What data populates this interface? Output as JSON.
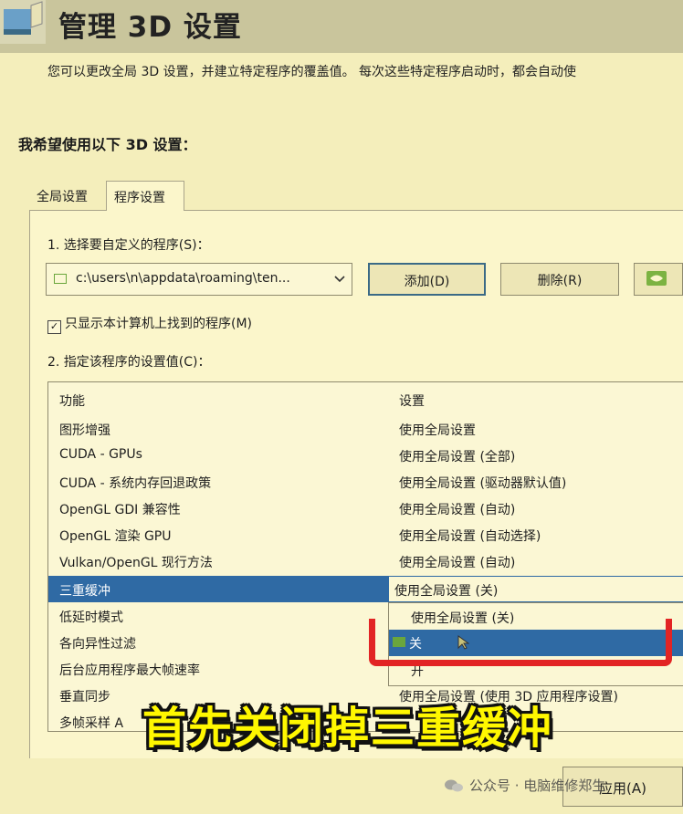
{
  "window": {
    "title": "管理 3D 设置"
  },
  "intro_text": "您可以更改全局 3D 设置，并建立特定程序的覆盖值。 每次这些特定程序启动时，都会自动使",
  "section_label": "我希望使用以下 3D 设置：",
  "tabs": [
    {
      "label": "全局设置",
      "active": false
    },
    {
      "label": "程序设置",
      "active": true
    }
  ],
  "step1": {
    "label": "1. 选择要自定义的程序(S)：",
    "selected_program": "c:\\users\\n\\appdata\\roaming\\ten...",
    "add_button": "添加(D)",
    "remove_button": "删除(R)"
  },
  "checkbox": {
    "label": "只显示本计算机上找到的程序(M)",
    "checked": true
  },
  "step2": {
    "label": "2. 指定该程序的设置值(C)："
  },
  "table": {
    "headers": [
      "功能",
      "设置"
    ],
    "rows": [
      {
        "feature": "图形增强",
        "value": "使用全局设置"
      },
      {
        "feature": "CUDA - GPUs",
        "value": "使用全局设置 (全部)"
      },
      {
        "feature": "CUDA - 系统内存回退政策",
        "value": "使用全局设置 (驱动器默认值)"
      },
      {
        "feature": "OpenGL GDI 兼容性",
        "value": "使用全局设置 (自动)"
      },
      {
        "feature": "OpenGL 渲染 GPU",
        "value": "使用全局设置 (自动选择)"
      },
      {
        "feature": "Vulkan/OpenGL 现行方法",
        "value": "使用全局设置 (自动)"
      },
      {
        "feature": "三重缓冲",
        "value": "",
        "selected": true
      },
      {
        "feature": "低延时模式",
        "value": ""
      },
      {
        "feature": "各向异性过滤",
        "value": ""
      },
      {
        "feature": "后台应用程序最大帧速率",
        "value": ""
      },
      {
        "feature": "垂直同步",
        "value": "使用全局设置 (使用 3D 应用程序设置)"
      },
      {
        "feature": "多帧采样 A",
        "value": ""
      }
    ]
  },
  "dropdown": {
    "current": "使用全局设置 (关)",
    "options": [
      {
        "label": "使用全局设置 (关)",
        "highlighted": false
      },
      {
        "label": "关",
        "highlighted": true
      },
      {
        "label": "开",
        "highlighted": false
      }
    ]
  },
  "caption": "首先关闭掉三重缓冲",
  "apply_button": "应用(A)",
  "watermark": "公众号 · 电脑维修郑生",
  "colors": {
    "background": "#f4eebb",
    "selection": "#2f6aa4",
    "highlight": "#e22424",
    "caption": "#fff700"
  },
  "icons": [
    "nvidia-control-panel-icon",
    "program-icon",
    "chevron-down-icon",
    "nvidia-icon",
    "cursor-icon",
    "wechat-icon"
  ]
}
